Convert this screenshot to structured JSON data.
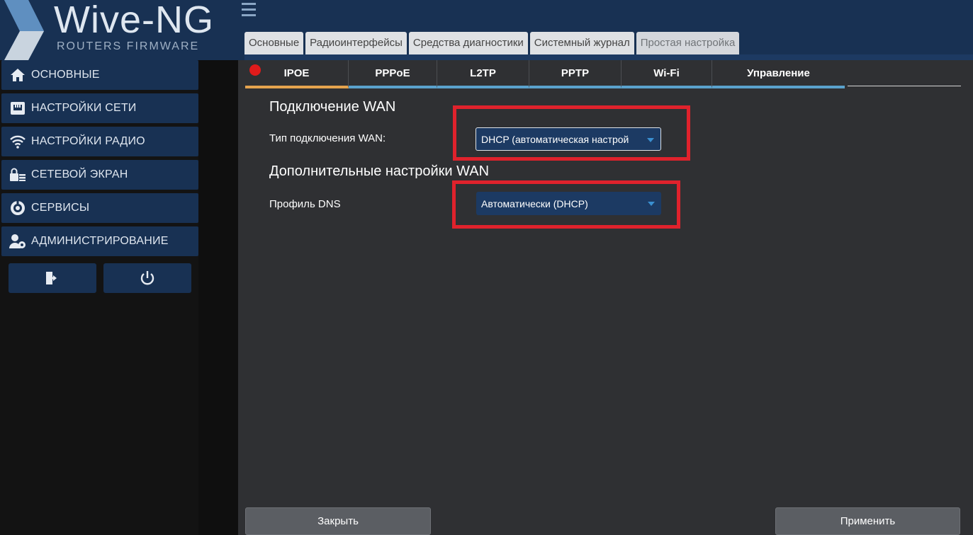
{
  "brand": {
    "title": "Wive-NG",
    "subtitle": "ROUTERS FIRMWARE"
  },
  "header": {
    "tabs": [
      {
        "label": "Основные"
      },
      {
        "label": "Радиоинтерфейсы"
      },
      {
        "label": "Средства диагностики"
      },
      {
        "label": "Системный журнал"
      },
      {
        "label": "Простая настройка"
      }
    ],
    "active_tab": "Простая настройка"
  },
  "sidebar": {
    "items": [
      {
        "label": "ОСНОВНЫЕ",
        "icon": "home-icon"
      },
      {
        "label": "НАСТРОЙКИ СЕТИ",
        "icon": "ethernet-icon"
      },
      {
        "label": "НАСТРОЙКИ РАДИО",
        "icon": "wifi-icon"
      },
      {
        "label": "СЕТЕВОЙ ЭКРАН",
        "icon": "firewall-icon"
      },
      {
        "label": "СЕРВИСЫ",
        "icon": "services-icon"
      },
      {
        "label": "АДМИНИСТРИРОВАНИЕ",
        "icon": "admin-icon"
      }
    ],
    "buttons": [
      {
        "icon": "logout-icon"
      },
      {
        "icon": "power-icon"
      }
    ]
  },
  "content": {
    "sub_tabs": [
      {
        "label": "IPOE"
      },
      {
        "label": "PPPoE"
      },
      {
        "label": "L2TP"
      },
      {
        "label": "PPTP"
      },
      {
        "label": "Wi-Fi"
      },
      {
        "label": "Управление"
      }
    ],
    "active_sub_tab": "IPOE",
    "wan_section": {
      "heading": "Подключение WAN",
      "type_label": "Тип подключения WAN:",
      "type_value": "DHCP (автоматическая настрой"
    },
    "wan_extra_section": {
      "heading": "Дополнительные настройки WAN",
      "dns_label": "Профиль DNS",
      "dns_value": "Автоматически (DHCP)"
    },
    "buttons": {
      "close": "Закрыть",
      "apply": "Применить"
    }
  },
  "colors": {
    "header_bg": "#183153",
    "sidebar_item_bg": "#183153",
    "content_bg": "#2f3033",
    "active_tab_underline": "#e5a34e",
    "tab_underline": "#5aa1cc",
    "highlight": "#e0222c",
    "status_dot": "#e01b1b"
  }
}
